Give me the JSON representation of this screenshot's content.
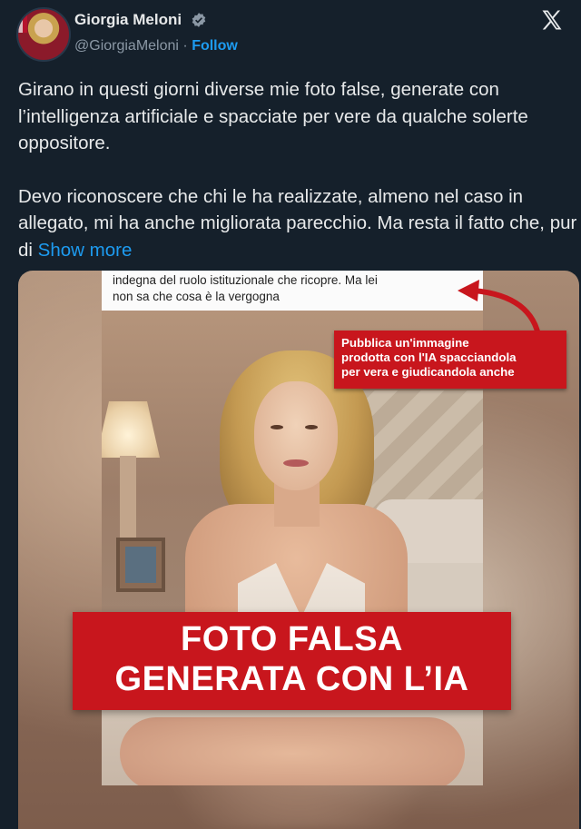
{
  "author": {
    "name": "Giorgia Meloni",
    "handle": "@GiorgiaMeloni",
    "separator": "·",
    "follow_label": "Follow",
    "verified_icon": "verified-badge-icon"
  },
  "close_icon": "x-logo-icon",
  "post": {
    "paragraph1": "Girano in questi giorni diverse mie foto false, generate con l’intelligenza artificiale e spacciate per vere da qualche solerte oppositore.",
    "paragraph2": "Devo riconoscere che chi le ha realizzate, almeno nel caso in allegato, mi ha anche migliorata parecchio. Ma resta il fatto che, pur di",
    "show_more": "Show more"
  },
  "media": {
    "quote_line1": "indegna del ruolo istituzionale che ricopre. Ma lei",
    "quote_line2": "non sa che cosa è la vergogna",
    "callout_line1": "Pubblica un'immagine",
    "callout_line2": "prodotta con l'IA spacciandola",
    "callout_line3": "per vera e giudicandola anche",
    "banner_line1": "FOTO FALSA",
    "banner_line2": "GENERATA CON L’IA"
  },
  "colors": {
    "background": "#15202b",
    "text": "#e7e9ea",
    "secondary": "#8b98a5",
    "link": "#1d9bf0",
    "banner_red": "#c8161d"
  }
}
